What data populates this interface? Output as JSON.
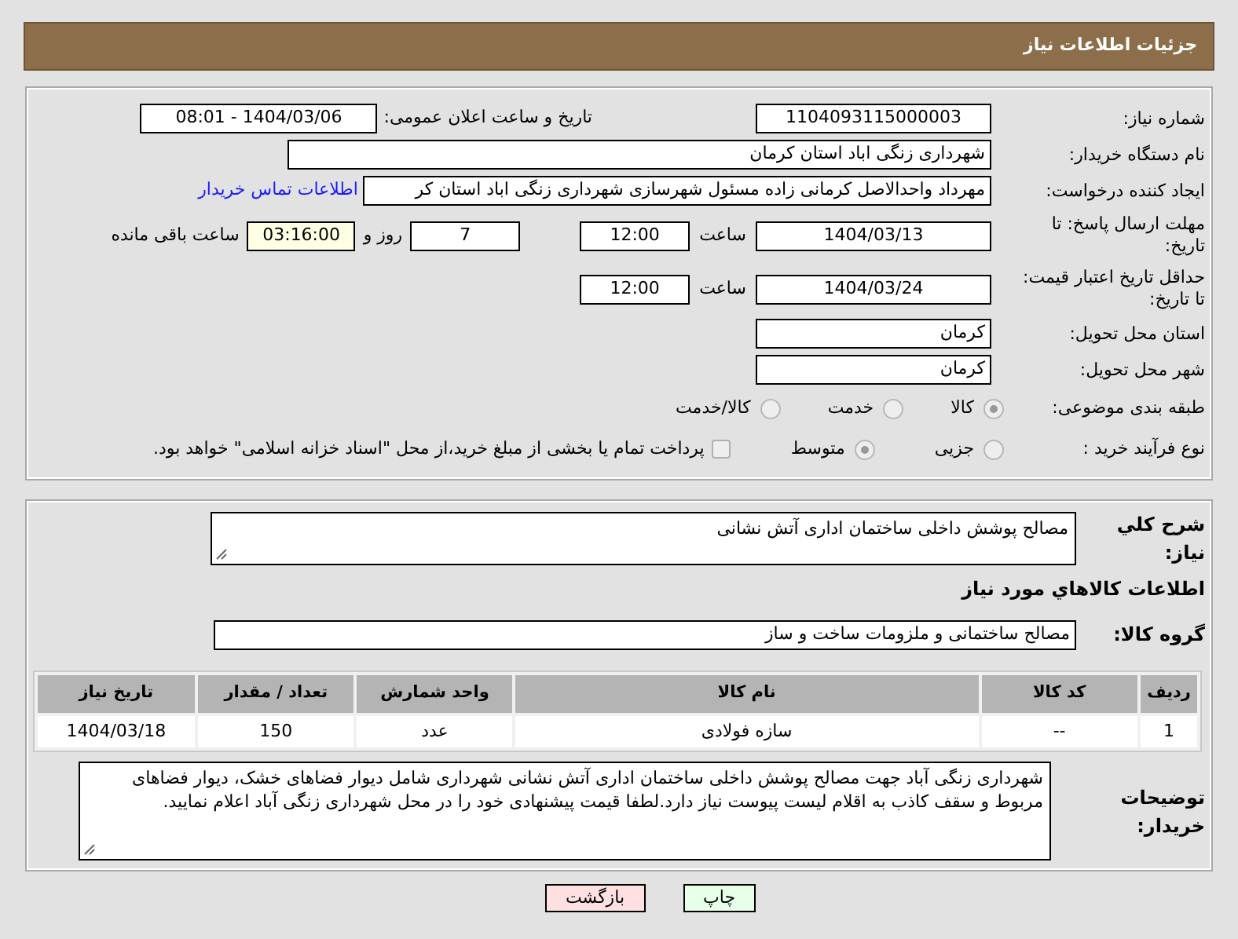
{
  "header": {
    "title": "جزئیات اطلاعات نیاز"
  },
  "need_number": {
    "label": "شماره نیاز:",
    "value": "1104093115000003"
  },
  "announce": {
    "label": "تاریخ و ساعت اعلان عمومی:",
    "value": "1404/03/06 - 08:01"
  },
  "buyer_org": {
    "label": "نام دستگاه خریدار:",
    "value": "شهرداری زنگی اباد استان کرمان"
  },
  "requester": {
    "label": "ایجاد کننده درخواست:",
    "value": "مهرداد واحدالاصل کرمانی زاده مسئول شهرسازی شهرداری زنگی اباد استان کر",
    "link": "اطلاعات تماس خریدار"
  },
  "deadline": {
    "label": "مهلت ارسال پاسخ: تا تاریخ:",
    "date": "1404/03/13",
    "time_label": "ساعت",
    "time": "12:00",
    "days": "7",
    "days_label": "روز و",
    "remaining": "03:16:00",
    "remaining_label": "ساعت باقی مانده"
  },
  "validity": {
    "label": "حداقل تاریخ اعتبار قیمت: تا تاریخ:",
    "date": "1404/03/24",
    "time_label": "ساعت",
    "time": "12:00"
  },
  "province": {
    "label": "استان محل تحویل:",
    "value": "کرمان"
  },
  "city": {
    "label": "شهر محل تحویل:",
    "value": "کرمان"
  },
  "category": {
    "label": "طبقه بندی موضوعی:",
    "options": [
      {
        "label": "کالا",
        "selected": true
      },
      {
        "label": "خدمت",
        "selected": false
      },
      {
        "label": "کالا/خدمت",
        "selected": false
      }
    ]
  },
  "process": {
    "label": "نوع فرآیند خرید :",
    "options": [
      {
        "label": "جزیی",
        "selected": false
      },
      {
        "label": "متوسط",
        "selected": true
      }
    ],
    "payment": {
      "checked": false,
      "text": "پرداخت تمام یا بخشی از مبلغ خرید،از محل \"اسناد خزانه اسلامی\" خواهد بود."
    }
  },
  "description": {
    "label": "شرح کلي نياز:",
    "value": "مصالح پوشش داخلی ساختمان اداری آتش نشانی"
  },
  "goods_title": "اطلاعات کالاهاي مورد نياز",
  "goods_group": {
    "label": "گروه کالا:",
    "value": "مصالح ساختمانی و ملزومات ساخت و ساز"
  },
  "table": {
    "columns": [
      "ردیف",
      "کد کالا",
      "نام کالا",
      "واحد شمارش",
      "تعداد / مقدار",
      "تاریخ نیاز"
    ],
    "rows": [
      [
        "1",
        "--",
        "سازه فولادی",
        "عدد",
        "150",
        "1404/03/18"
      ]
    ]
  },
  "buyer_notes": {
    "label": "توضیحات خریدار:",
    "value": "شهرداری زنگی آباد جهت مصالح پوشش داخلی ساختمان اداری آتش نشانی شهرداری شامل دیوار فضاهای خشک، دیوار فضاهای مربوط و سقف کاذب به اقلام لیست پیوست نیاز دارد.لطفا قیمت پیشنهادی خود را در محل شهرداری زنگی آباد اعلام نمایید."
  },
  "buttons": [
    {
      "label": "چاپ",
      "kind": "print"
    },
    {
      "label": "بازگشت",
      "kind": "back"
    }
  ]
}
